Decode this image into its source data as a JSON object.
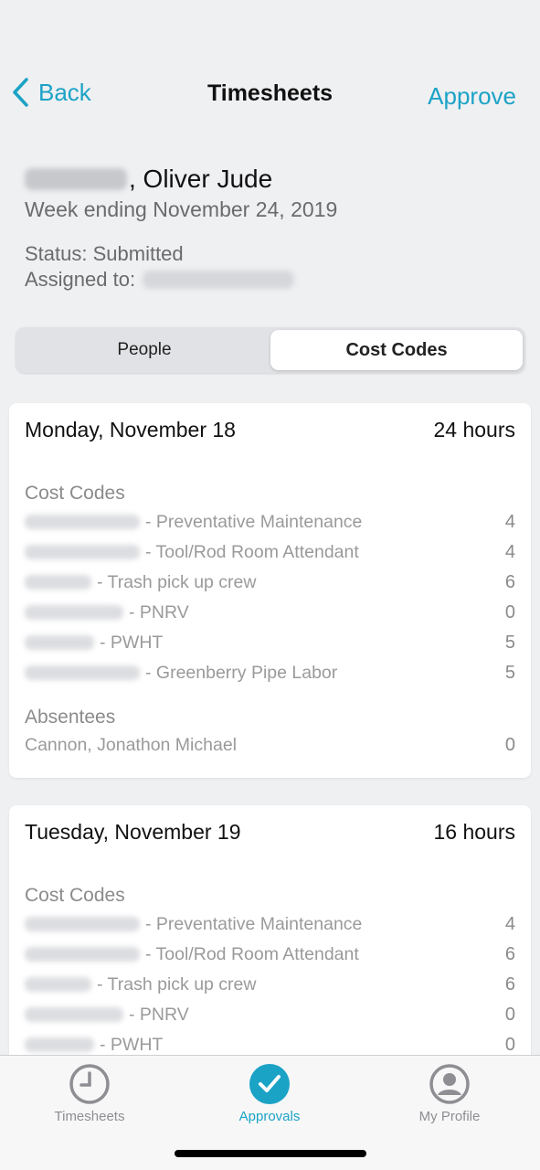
{
  "nav": {
    "back_label": "Back",
    "title": "Timesheets",
    "approve_label": "Approve"
  },
  "header": {
    "name_suffix": ", Oliver Jude",
    "week": "Week ending November 24, 2019",
    "status": "Status: Submitted",
    "assigned_label": "Assigned to:"
  },
  "segments": {
    "people": "People",
    "cost_codes": "Cost Codes",
    "selected": "Cost Codes"
  },
  "days": [
    {
      "title": "Monday, November 18",
      "total": "24 hours",
      "cost_codes_label": "Cost Codes",
      "codes": [
        {
          "name": "- Preventative Maintenance",
          "hours": "4"
        },
        {
          "name": "- Tool/Rod Room Attendant",
          "hours": "4"
        },
        {
          "name": "- Trash pick up crew",
          "hours": "6"
        },
        {
          "name": "- PNRV",
          "hours": "0"
        },
        {
          "name": "- PWHT",
          "hours": "5"
        },
        {
          "name": "- Greenberry Pipe Labor",
          "hours": "5"
        }
      ],
      "absentees_label": "Absentees",
      "absentees": [
        {
          "name": "Cannon, Jonathon Michael",
          "hours": "0"
        }
      ]
    },
    {
      "title": "Tuesday, November 19",
      "total": "16 hours",
      "cost_codes_label": "Cost Codes",
      "codes": [
        {
          "name": "- Preventative Maintenance",
          "hours": "4"
        },
        {
          "name": "- Tool/Rod Room Attendant",
          "hours": "6"
        },
        {
          "name": "- Trash pick up crew",
          "hours": "6"
        },
        {
          "name": "- PNRV",
          "hours": "0"
        },
        {
          "name": "- PWHT",
          "hours": "0"
        }
      ]
    }
  ],
  "tabs": [
    {
      "label": "Timesheets",
      "icon": "clock-icon"
    },
    {
      "label": "Approvals",
      "icon": "checkmark-circle-icon",
      "active": true
    },
    {
      "label": "My Profile",
      "icon": "person-icon"
    }
  ],
  "colors": {
    "accent": "#1ba3c6",
    "background": "#eff0f2",
    "muted_text": "#9a9a9a"
  }
}
